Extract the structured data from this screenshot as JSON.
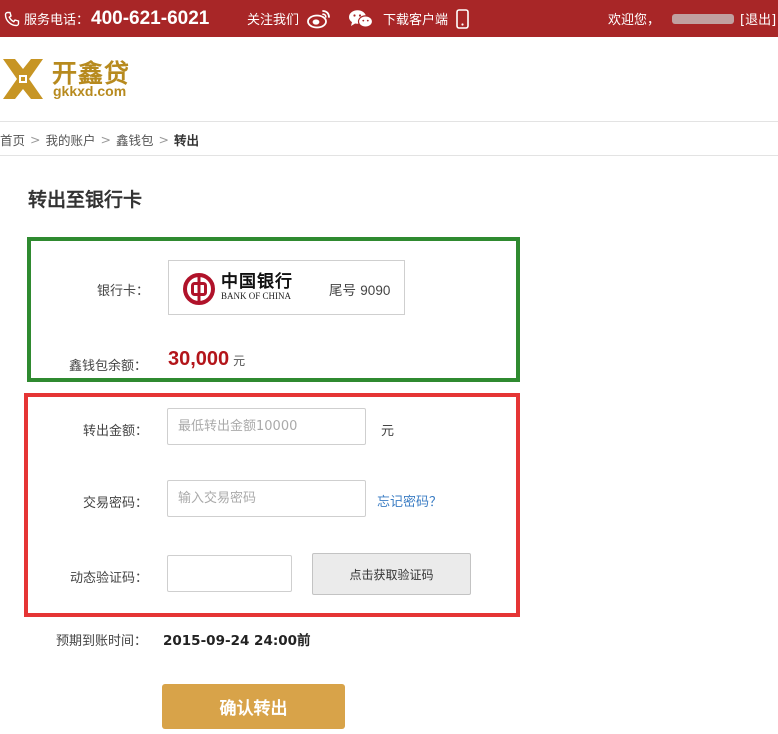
{
  "topbar": {
    "hotline_label": "服务电话：",
    "hotline_number": "400-621-6021",
    "follow_label": "关注我们",
    "download_label": "下载客户端",
    "welcome": "欢迎您，",
    "logout": "[退出]"
  },
  "logo": {
    "name": "开鑫贷",
    "domain": "gkkxd.com"
  },
  "breadcrumb": {
    "items": [
      "首页",
      "我的账户",
      "鑫钱包",
      "转出"
    ],
    "separator": ">"
  },
  "page_title": "转出至银行卡",
  "bank_section": {
    "bank_card_label": "银行卡：",
    "bank_name_cn": "中国银行",
    "bank_name_en": "BANK OF CHINA",
    "tail_label": "尾号",
    "tail_number": "9090",
    "balance_label": "鑫钱包余额：",
    "balance_amount": "30,000",
    "balance_unit": "元"
  },
  "form": {
    "amount_label": "转出金额：",
    "amount_placeholder": "最低转出金额10000",
    "amount_unit": "元",
    "password_label": "交易密码：",
    "password_placeholder": "输入交易密码",
    "forgot_password": "忘记密码？",
    "code_label": "动态验证码：",
    "code_value": "",
    "get_code_button": "点击获取验证码"
  },
  "eta": {
    "label": "预期到账时间：",
    "value": "2015-09-24 24:00前"
  },
  "confirm_button": "确认转出",
  "colors": {
    "topbar": "#a82627",
    "brand_gold": "#b78a1e",
    "green_highlight": "#2f8a30",
    "red_highlight": "#e53535",
    "balance_red": "#b3151a",
    "confirm_button": "#d8a349",
    "link_blue": "#3b7dc4"
  }
}
